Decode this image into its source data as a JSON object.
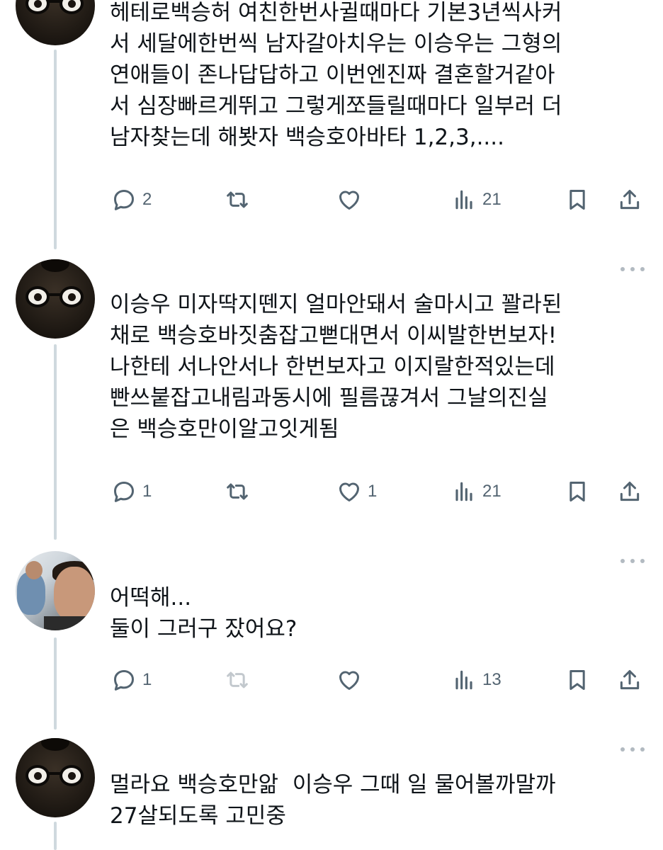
{
  "replies": [
    {
      "avatar": "glasses-character",
      "text": "헤테로백승허 여친한번사귈때마다 기본3년씩사커\n서 세달에한번씩 남자갈아치우는 이승우는 그형의\n연애들이 존나답답하고 이번엔진짜 결혼할거같아\n서 심장빠르게뛰고 그렇게쪼들릴때마다 일부러 더\n남자찾는데 해봣자 백승호아바타 1,2,3,....",
      "reply_count": "2",
      "retweet_count": "",
      "like_count": "",
      "view_count": "21",
      "show_more": false
    },
    {
      "avatar": "glasses-character",
      "text": "이승우 미자딱지뗀지 얼마안돼서 술마시고 꽐라된\n채로 백승호바짓춤잡고뻗대면서 이씨발한번보자!\n나한테 서나안서나 한번보자고 이지랄한적있는데\n빤쓰붙잡고내림과동시에 필름끊겨서 그날의진실\n은 백승호만이알고잇게됨",
      "reply_count": "1",
      "retweet_count": "",
      "like_count": "1",
      "view_count": "21",
      "show_more": true
    },
    {
      "avatar": "photo",
      "text": "어떡해...\n둘이 그러구 잤어요?",
      "reply_count": "1",
      "retweet_count": "",
      "like_count": "",
      "view_count": "13",
      "show_more": true,
      "retweet_disabled": true
    },
    {
      "avatar": "glasses-character",
      "text": "멀라요 백승호만앎  이승우 그때 일 물어볼까말까\n27살되도록 고민중",
      "show_more": true
    }
  ],
  "icons": {
    "reply": "reply-icon",
    "retweet": "retweet-icon",
    "like": "like-icon",
    "views": "views-icon",
    "bookmark": "bookmark-icon",
    "share": "share-icon",
    "more": "more-icon"
  },
  "colors": {
    "icon": "#536471",
    "text": "#0f1419",
    "thread_line": "#cfd9de"
  }
}
